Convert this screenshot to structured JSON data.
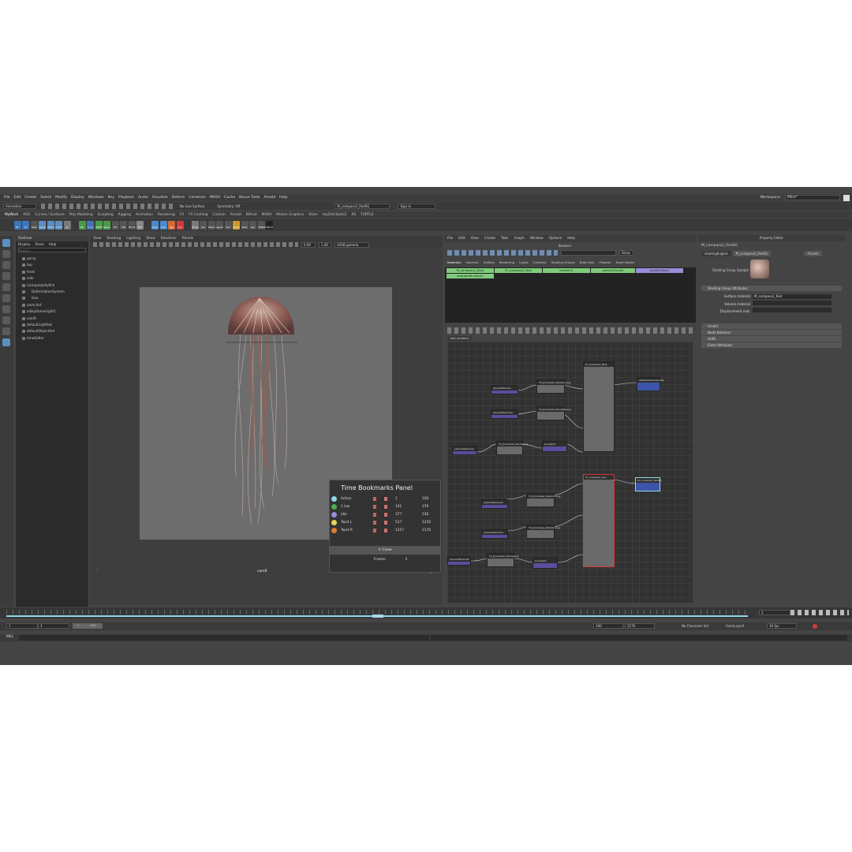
{
  "menus": [
    "File",
    "Edit",
    "Create",
    "Select",
    "Modify",
    "Display",
    "Windows",
    "Key",
    "Playback",
    "Audio",
    "Visualize",
    "Deform",
    "Constrain",
    "MASH",
    "Cache",
    "Bonus Tools",
    "Arnold",
    "Help"
  ],
  "workspace": {
    "label": "Workspace:",
    "value": "Mike*"
  },
  "status": {
    "mode": "Animation",
    "live_surface": "No Live Surface",
    "symmetry": "Symmetry: Off",
    "selected_object": "M_compass2_RedSG",
    "sign_in": "Sign In"
  },
  "shelf_tabs": [
    "MyWork",
    "XGS",
    "Curves / Surfaces",
    "Poly Modeling",
    "Sculpting",
    "Rigging",
    "Animation",
    "Rendering",
    "FX",
    "FX Caching",
    "Custom",
    "Arnold",
    "Bifrost",
    "MASH",
    "Motion Graphics",
    "XGen",
    "myDistribute2",
    "RS",
    "TURTLE"
  ],
  "shelf_icons": [
    "BT",
    "CP",
    "reset",
    "Orient",
    "CTRLs",
    "CV-CV",
    "JS",
    "Rfu",
    "P->S",
    "CONST",
    "Squrares",
    "MT",
    "MR",
    "MT->S",
    "RAT",
    "Graph",
    "Color",
    "Bez",
    "Curv",
    "CB Key",
    "bat",
    "Ribbon",
    "export",
    "Corn",
    "Spider",
    "Build",
    "Dyn",
    "OVERLE",
    "Hlatural"
  ],
  "outliner": {
    "title": "Outliner",
    "menu": [
      "Display",
      "Show",
      "Help"
    ],
    "search_placeholder": "Search...",
    "items": [
      "persp",
      "top",
      "front",
      "side",
      "CompassJellyfish",
      "DeformationSystem",
      "Geo",
      "anim:ikrt",
      "aiSkyDomeLight1",
      "camR",
      "defaultLightSet",
      "defaultObjectSet",
      "timeEditor"
    ]
  },
  "viewport": {
    "menu": [
      "View",
      "Shading",
      "Lighting",
      "Show",
      "Renderer",
      "Panels"
    ],
    "exposure": "0.00",
    "gamma": "1.00",
    "color_space": "sRGB gamma",
    "camera": "camR",
    "fps": "1.3 fps"
  },
  "time_bookmarks": {
    "title": "Time Bookmarks Panel",
    "rows": [
      {
        "name": "Action",
        "start": "1",
        "end": "100",
        "color": "#8fd9e8"
      },
      {
        "name": "1 low",
        "start": "101",
        "end": "376",
        "color": "#4caf50"
      },
      {
        "name": "idle",
        "start": "377",
        "end": "536",
        "color": "#9b8bd8"
      },
      {
        "name": "Twist L",
        "start": "537",
        "end": "1256",
        "color": "#e8d35a"
      },
      {
        "name": "Twist R",
        "start": "1257",
        "end": "2176",
        "color": "#e07b39"
      }
    ],
    "close_label": "Close",
    "frame_label": "Frame:",
    "frame_value": "1"
  },
  "hypershade": {
    "menu": [
      "File",
      "Edit",
      "View",
      "Create",
      "Tabs",
      "Graph",
      "Window",
      "Options",
      "Help"
    ],
    "browser_title": "Browser",
    "show_label": "Show",
    "browser_tabs": [
      "Materials",
      "Volumes",
      "Utilities",
      "Rendering",
      "Lights",
      "Cameras",
      "Shading Groups",
      "Bake Sets",
      "Projects",
      "Asset Nodes"
    ],
    "materials": [
      "M_compass1_Blue",
      "M_compass2_Red",
      "lambert1",
      "particleCloud1",
      "shaderGlow1",
      "standardSurface1"
    ],
    "graph_tab": "last shaders",
    "nodes": [
      "place2dTexture",
      "TX_JCompass_Albedo1.png",
      "place2dTexture2",
      "TX_JCompass_NormalR.png",
      "TX_JCompass_Normapng",
      "bump2d1",
      "M_compass1_Blue",
      "aiStandardSurfaceSG",
      "place2dTexture3",
      "TX_JCompass_Albedo2.png",
      "place2dTexture4",
      "TX_JCompass_Metallic.png",
      "bump2d2",
      "M_compass2_Red",
      "M_compass2_RedSG"
    ]
  },
  "attribute_editor": {
    "title": "Property Editor",
    "node": "M_compass2_RedSG",
    "tabs": [
      "shadingEngine",
      "M_compass2_RedSG",
      "Presets"
    ],
    "sample_label": "Shading Group Sample",
    "section": "Shading Group Attributes",
    "fields": [
      {
        "label": "Surface material",
        "value": "M_compass2_Red"
      },
      {
        "label": "Volume material",
        "value": ""
      },
      {
        "label": "Displacement mat.",
        "value": ""
      }
    ],
    "collapsed": [
      "Arnold",
      "Node Behavior",
      "UUID",
      "Extra Attributes"
    ]
  },
  "timeline": {
    "start": "1",
    "start2": "1",
    "range_start": "1",
    "range_end": "100",
    "end": "100",
    "end2": "2176",
    "character_set": "No Character Set",
    "anim_layer": "AnimLayer1",
    "fps": "30 fps",
    "cmd_label": "MEL",
    "current_frame": "1"
  }
}
